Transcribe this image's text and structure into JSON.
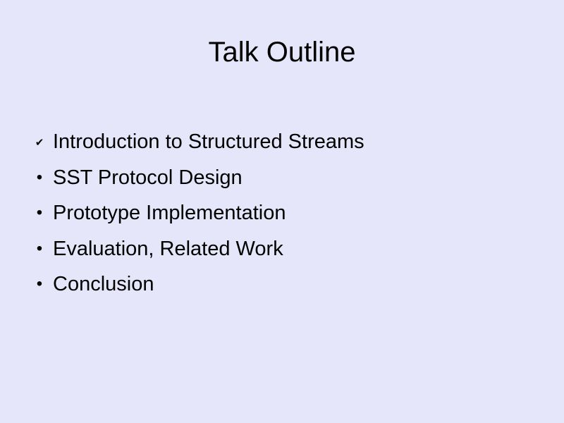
{
  "slide": {
    "title": "Talk Outline",
    "items": [
      {
        "marker": "✔",
        "marker_icon": "checkmark-icon",
        "label": "Introduction to Structured Streams"
      },
      {
        "marker": "•",
        "marker_icon": "bullet-icon",
        "label": "SST Protocol Design"
      },
      {
        "marker": "•",
        "marker_icon": "bullet-icon",
        "label": "Prototype Implementation"
      },
      {
        "marker": "•",
        "marker_icon": "bullet-icon",
        "label": "Evaluation, Related Work"
      },
      {
        "marker": "•",
        "marker_icon": "bullet-icon",
        "label": "Conclusion"
      }
    ]
  },
  "colors": {
    "background": "#e6e6fb",
    "text": "#000000"
  }
}
